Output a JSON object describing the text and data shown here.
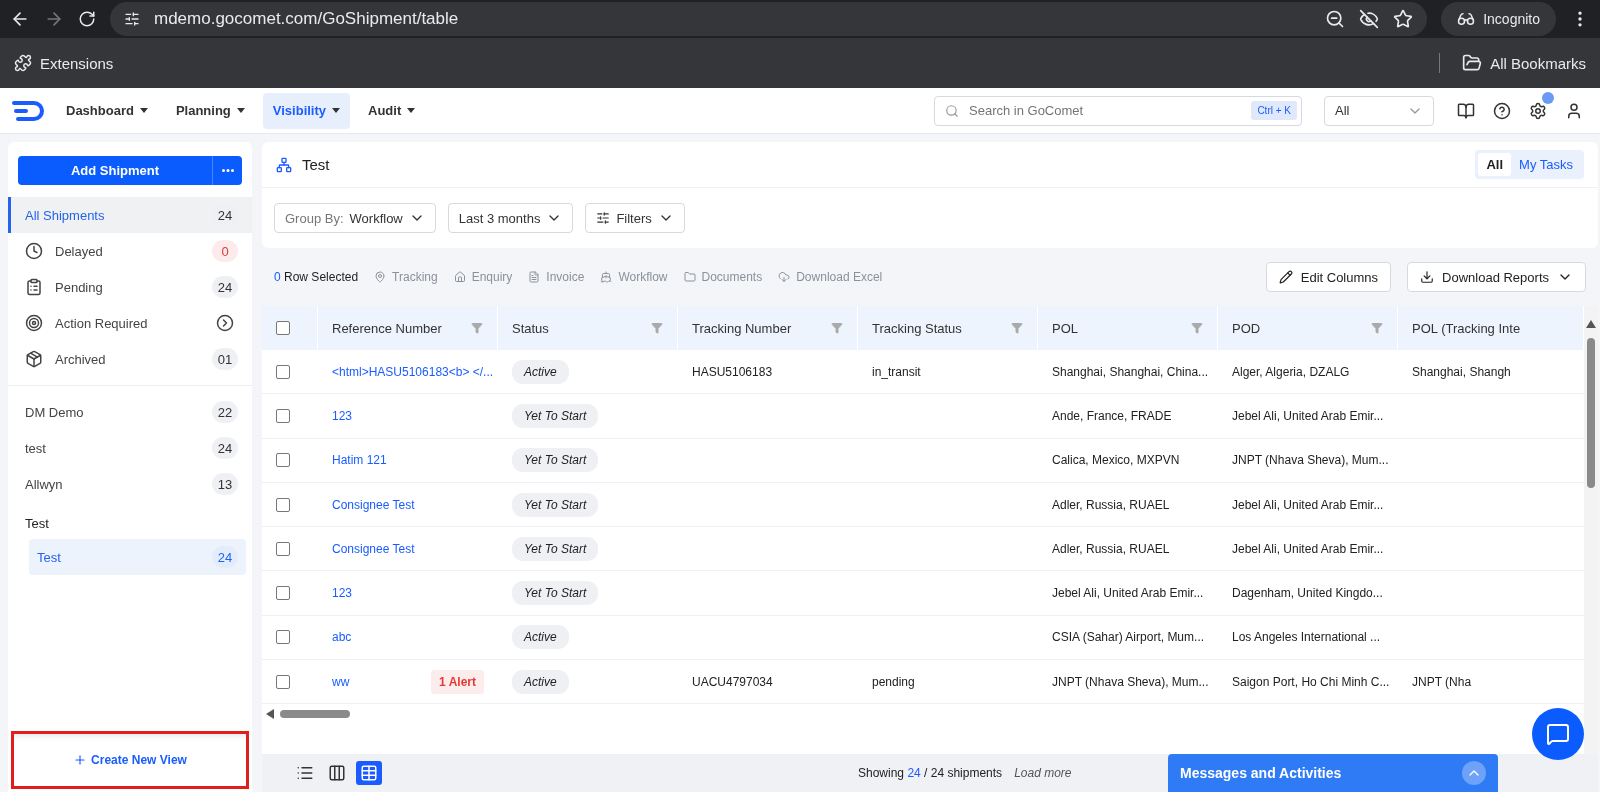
{
  "browser": {
    "url": "mdemo.gocomet.com/GoShipment/table",
    "profile": "Incognito",
    "bookmarks_left": "Extensions",
    "bookmarks_right": "All Bookmarks"
  },
  "nav": {
    "items": [
      {
        "label": "Dashboard",
        "selected": false
      },
      {
        "label": "Planning",
        "selected": false
      },
      {
        "label": "Visibility",
        "selected": true
      },
      {
        "label": "Audit",
        "selected": false
      }
    ],
    "search": {
      "placeholder": "Search in GoComet",
      "shortcut": "Ctrl + K"
    },
    "scope": {
      "value": "All"
    },
    "notification_dot": true
  },
  "sidebar": {
    "add_button": "Add Shipment",
    "items": [
      {
        "label": "All Shipments",
        "count": "24",
        "kind": "count",
        "selected": true
      },
      {
        "label": "Delayed",
        "count": "0",
        "kind": "alert",
        "selected": false
      },
      {
        "label": "Pending",
        "count": "24",
        "kind": "count",
        "selected": false
      },
      {
        "label": "Action Required",
        "kind": "link",
        "selected": false
      },
      {
        "label": "Archived",
        "count": "01",
        "kind": "count",
        "selected": false
      }
    ],
    "views": [
      {
        "label": "DM Demo",
        "count": "22",
        "selected": false
      },
      {
        "label": "test",
        "count": "24",
        "selected": false
      },
      {
        "label": "Allwyn",
        "count": "13",
        "selected": false
      }
    ],
    "groups": [
      {
        "label": "Test",
        "children": [
          {
            "label": "Test",
            "count": "24",
            "selected": true
          }
        ]
      }
    ],
    "create_view": {
      "label": "Create New View",
      "highlighted": true
    }
  },
  "main": {
    "title": "Test",
    "scope_tabs": [
      {
        "label": "All",
        "selected": true
      },
      {
        "label": "My Tasks",
        "selected": false
      }
    ],
    "filters": [
      {
        "label": "Group By:",
        "value": "Workflow"
      },
      {
        "value": "Last 3 months"
      },
      {
        "value": "Filters"
      }
    ],
    "selection": {
      "count": "0",
      "label": "Row Selected"
    },
    "actions": [
      {
        "label": "Tracking",
        "disabled": true
      },
      {
        "label": "Enquiry",
        "disabled": true
      },
      {
        "label": "Invoice",
        "disabled": true
      },
      {
        "label": "Workflow",
        "disabled": true
      },
      {
        "label": "Documents",
        "disabled": true
      },
      {
        "label": "Download Excel",
        "disabled": true
      }
    ],
    "edit_columns": "Edit Columns",
    "download_reports": "Download Reports"
  },
  "table": {
    "header_checked": false,
    "columns": [
      "Reference Number",
      "Status",
      "Tracking Number",
      "Tracking Status",
      "POL",
      "POD",
      "POL (Tracking Inte"
    ],
    "rows": [
      {
        "checked": false,
        "reference": "<html>HASU5106183<b> </...",
        "status": "Active",
        "tracking_number": "HASU5106183",
        "tracking_status": "in_transit",
        "pol": "Shanghai, Shanghai, China...",
        "pod": "Alger, Algeria, DZALG",
        "pol_tracking": "Shanghai, Shangh"
      },
      {
        "checked": false,
        "reference": "123",
        "status": "Yet To Start",
        "pol": "Ande, France, FRADE",
        "pod": "Jebel Ali, United Arab Emir..."
      },
      {
        "checked": false,
        "reference": "Hatim 121",
        "status": "Yet To Start",
        "pol": "Calica, Mexico, MXPVN",
        "pod": "JNPT (Nhava Sheva), Mum..."
      },
      {
        "checked": false,
        "reference": "Consignee Test",
        "status": "Yet To Start",
        "pol": "Adler, Russia, RUAEL",
        "pod": "Jebel Ali, United Arab Emir..."
      },
      {
        "checked": false,
        "reference": "Consignee Test",
        "status": "Yet To Start",
        "pol": "Adler, Russia, RUAEL",
        "pod": "Jebel Ali, United Arab Emir..."
      },
      {
        "checked": false,
        "reference": "123",
        "status": "Yet To Start",
        "pol": "Jebel Ali, United Arab Emir...",
        "pod": "Dagenham, United Kingdo..."
      },
      {
        "checked": false,
        "reference": "abc",
        "status": "Active",
        "pol": "CSIA (Sahar) Airport, Mum...",
        "pod": "Los Angeles International ..."
      },
      {
        "checked": false,
        "reference": "ww",
        "alert": "1 Alert",
        "status": "Active",
        "tracking_number": "UACU4797034",
        "tracking_status": "pending",
        "pol": "JNPT (Nhava Sheva), Mum...",
        "pod": "Saigon Port, Ho Chi Minh C...",
        "pol_tracking": "JNPT (Nha"
      }
    ]
  },
  "footer": {
    "views": [
      {
        "kind": "list",
        "selected": false
      },
      {
        "kind": "columns",
        "selected": false
      },
      {
        "kind": "table",
        "selected": true
      }
    ],
    "showing": "Showing",
    "shown": "24",
    "total": "/ 24 shipments",
    "load_more": "Load more",
    "messages": "Messages and Activities"
  }
}
